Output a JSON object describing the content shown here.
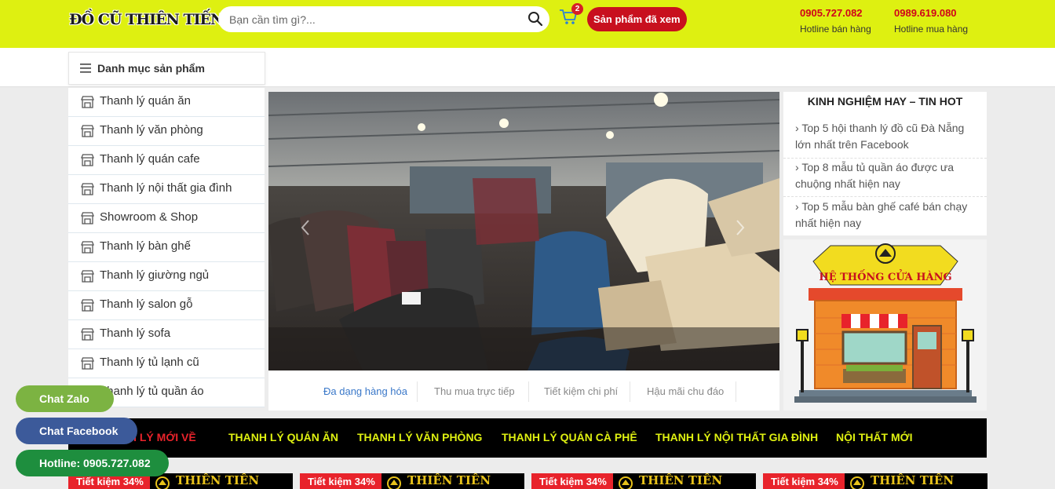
{
  "header": {
    "logo_text": "ĐỒ CŨ THIÊN TIẾN",
    "search_placeholder": "Bạn cần tìm gì?...",
    "cart_count": "2",
    "viewed_label": "Sản phẩm đã xem",
    "hotlines": [
      {
        "number": "0905.727.082",
        "label": "Hotline bán hàng"
      },
      {
        "number": "0989.619.080",
        "label": "Hotline mua hàng"
      }
    ]
  },
  "category_button": {
    "label": "Danh mục sản phẩm"
  },
  "categories": [
    "Thanh lý quán ăn",
    "Thanh lý văn phòng",
    "Thanh lý quán cafe",
    "Thanh lý nội thất gia đình",
    "Showroom & Shop",
    "Thanh lý bàn ghế",
    "Thanh lý giường ngủ",
    "Thanh lý salon gỗ",
    "Thanh lý sofa",
    "Thanh lý tủ lạnh cũ",
    "Thanh lý tủ quần áo"
  ],
  "slider": {
    "tabs": [
      "Đa dạng hàng hóa",
      "Thu mua trực tiếp",
      "Tiết kiệm chi phí",
      "Hậu mãi chu đáo"
    ],
    "active_tab": 0
  },
  "news": {
    "title": "KINH NGHIỆM HAY – TIN HOT",
    "items": [
      "Top 5 hội thanh lý đồ cũ Đà Nẵng lớn nhất trên Facebook",
      "Top 8 mẫu tủ quần áo được ưa chuộng nhất hiện nay",
      "Top 5 mẫu bàn ghế café bán chạy nhất hiện nay"
    ]
  },
  "store_banner": {
    "text": "HỆ THỐNG CỬA HÀNG"
  },
  "menu": [
    "THANH LÝ MỚI VỀ",
    "THANH LÝ QUÁN ĂN",
    "THANH LÝ VĂN PHÒNG",
    "THANH LÝ QUÁN CÀ PHÊ",
    "THANH LÝ NỘI THẤT GIA ĐÌNH",
    "NỘI THẤT MỚI"
  ],
  "products": [
    {
      "save": "Tiết kiệm 34%",
      "brand": "THIÊN TIẾN"
    },
    {
      "save": "Tiết kiệm 34%",
      "brand": "THIÊN TIẾN"
    },
    {
      "save": "Tiết kiệm 34%",
      "brand": "THIÊN TIẾN"
    },
    {
      "save": "Tiết kiệm 34%",
      "brand": "THIÊN TIẾN"
    }
  ],
  "floating": {
    "zalo": "Chat Zalo",
    "facebook": "Chat Facebook",
    "hotline": "Hotline: 0905.727.082"
  },
  "colors": {
    "header_bg": "#def011",
    "accent_red": "#c8101e",
    "menu_bg": "#000000",
    "menu_text": "#def011"
  }
}
